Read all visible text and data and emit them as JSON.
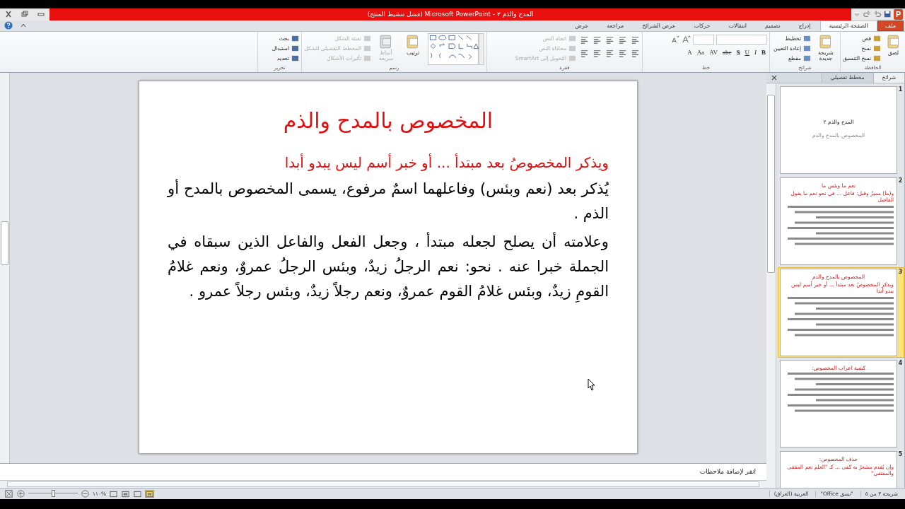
{
  "window": {
    "title": "المدح والذم ٢ - Microsoft PowerPoint (فشل تنشيط المنتج)",
    "app_icon": "P"
  },
  "ribbon": {
    "tabs": [
      {
        "label": "ملف",
        "kind": "file",
        "selected": false
      },
      {
        "label": "الصفحة الرئيسية",
        "kind": "tab",
        "selected": true
      },
      {
        "label": "إدراج",
        "kind": "tab",
        "selected": false
      },
      {
        "label": "تصميم",
        "kind": "tab",
        "selected": false
      },
      {
        "label": "انتقالات",
        "kind": "tab",
        "selected": false
      },
      {
        "label": "حركات",
        "kind": "tab",
        "selected": false
      },
      {
        "label": "عرض الشرائح",
        "kind": "tab",
        "selected": false
      },
      {
        "label": "مراجعة",
        "kind": "tab",
        "selected": false
      },
      {
        "label": "عرض",
        "kind": "tab",
        "selected": false
      }
    ],
    "groups": [
      {
        "label": "الحافظة",
        "kind": "clipboard",
        "large": [
          {
            "label": "لصق",
            "disabled": false
          }
        ],
        "small": [
          {
            "label": "قص",
            "disabled": false
          },
          {
            "label": "نسخ",
            "disabled": false
          },
          {
            "label": "نسخ التنسيق",
            "disabled": false
          }
        ]
      },
      {
        "label": "شرائح",
        "kind": "slides",
        "large": [
          {
            "label": "شريحة جديدة",
            "disabled": false
          }
        ],
        "small": [
          {
            "label": "تخطيط",
            "disabled": false
          },
          {
            "label": "إعادة التعيين",
            "disabled": false
          },
          {
            "label": "مقطع",
            "disabled": false
          }
        ]
      },
      {
        "label": "خط",
        "kind": "font",
        "glyphs": [
          "B",
          "I",
          "U",
          "S",
          "abc",
          "AV",
          "Aa",
          "A"
        ]
      },
      {
        "label": "فقرة",
        "kind": "paragraph",
        "small": [
          {
            "label": "اتجاه النص",
            "disabled": true
          },
          {
            "label": "محاذاة النص",
            "disabled": true
          },
          {
            "label": "التحويل إلى SmartArt",
            "disabled": true
          }
        ]
      },
      {
        "label": "رسم",
        "kind": "drawing",
        "large": [
          {
            "label": "ترتيب",
            "disabled": false
          },
          {
            "label": "أنماط سريعة",
            "disabled": true
          }
        ],
        "small": [
          {
            "label": "تعبئة الشكل",
            "disabled": true
          },
          {
            "label": "المخطط التفصيلي للشكل",
            "disabled": true
          },
          {
            "label": "تأثيرات الأشكال",
            "disabled": true
          }
        ]
      },
      {
        "label": "تحرير",
        "kind": "editing",
        "small": [
          {
            "label": "بحث",
            "disabled": false
          },
          {
            "label": "استبدال",
            "disabled": false
          },
          {
            "label": "تحديد",
            "disabled": false
          }
        ]
      }
    ]
  },
  "panel": {
    "tabs": [
      {
        "label": "شرائح",
        "selected": true
      },
      {
        "label": "مخطط تفصيلي",
        "selected": false
      }
    ],
    "thumbnails": [
      {
        "number": "1",
        "kind": "title",
        "selected": false,
        "title": "المدح والذم ٢",
        "subtitle": "المخصوص بالمدح والذم"
      },
      {
        "number": "2",
        "kind": "content",
        "selected": false,
        "title": "نعم ما وبئس ما",
        "subtitle": "و(ما) مميزٌ وقيل: فاعل ... في نحو نعم ما يقول الفاضل"
      },
      {
        "number": "3",
        "kind": "content",
        "selected": true,
        "title": "المخصوص بالمدح والذم",
        "subtitle": "ويذكر المخصوصُ بعد مبتدأ ... أو خبر أسم ليس يبدو أبدا"
      },
      {
        "number": "4",
        "kind": "content",
        "selected": false,
        "title": "كيفية اعراب المخصوص:"
      },
      {
        "number": "5",
        "kind": "heading",
        "selected": false,
        "title": "حذف المخصوص:",
        "subtitle": "وإن يُقدم مشعرٌ به كفى ... كـ \"العلم نعم المقتنى والمقتفى\""
      }
    ]
  },
  "slide": {
    "title": "المخصوص بالمدح والذم",
    "subtitle": "ويذكر المخصوصُ بعد مبتدأ ... أو خبر أسم ليس يبدو أبدا",
    "paragraphs": [
      "يُذكر بعد (نعم وبئس) وفاعلهما اسمٌ مرفوع، يسمى المخصوص بالمدح أو الذم .",
      "وعلامته أن يصلح لجعله مبتدأ ، وجعل الفعل والفاعل الذين سبقاه في الجملة خبرا عنه . نحو:  نعم الرجلُ زيدٌ، وبئس الرجلُ عمروٌ، ونعم غلامُ القومِ زيدٌ، وبئس غلامُ القوم عمروٌ، ونعم رجلاً زيدٌ، وبئس رجلاً عمرو ."
    ]
  },
  "notes": {
    "placeholder": "انقر لإضافة ملاحظات"
  },
  "status_bar": {
    "items": [
      "شريحة ٣ من ٥",
      "\"نسق Office\"",
      "العربية (العراق)"
    ],
    "zoom": "%١١٠",
    "zoom_slider": {
      "level": 0.5
    },
    "views": [
      {
        "selected": false
      },
      {
        "selected": false
      },
      {
        "selected": false
      },
      {
        "selected": true
      }
    ]
  }
}
